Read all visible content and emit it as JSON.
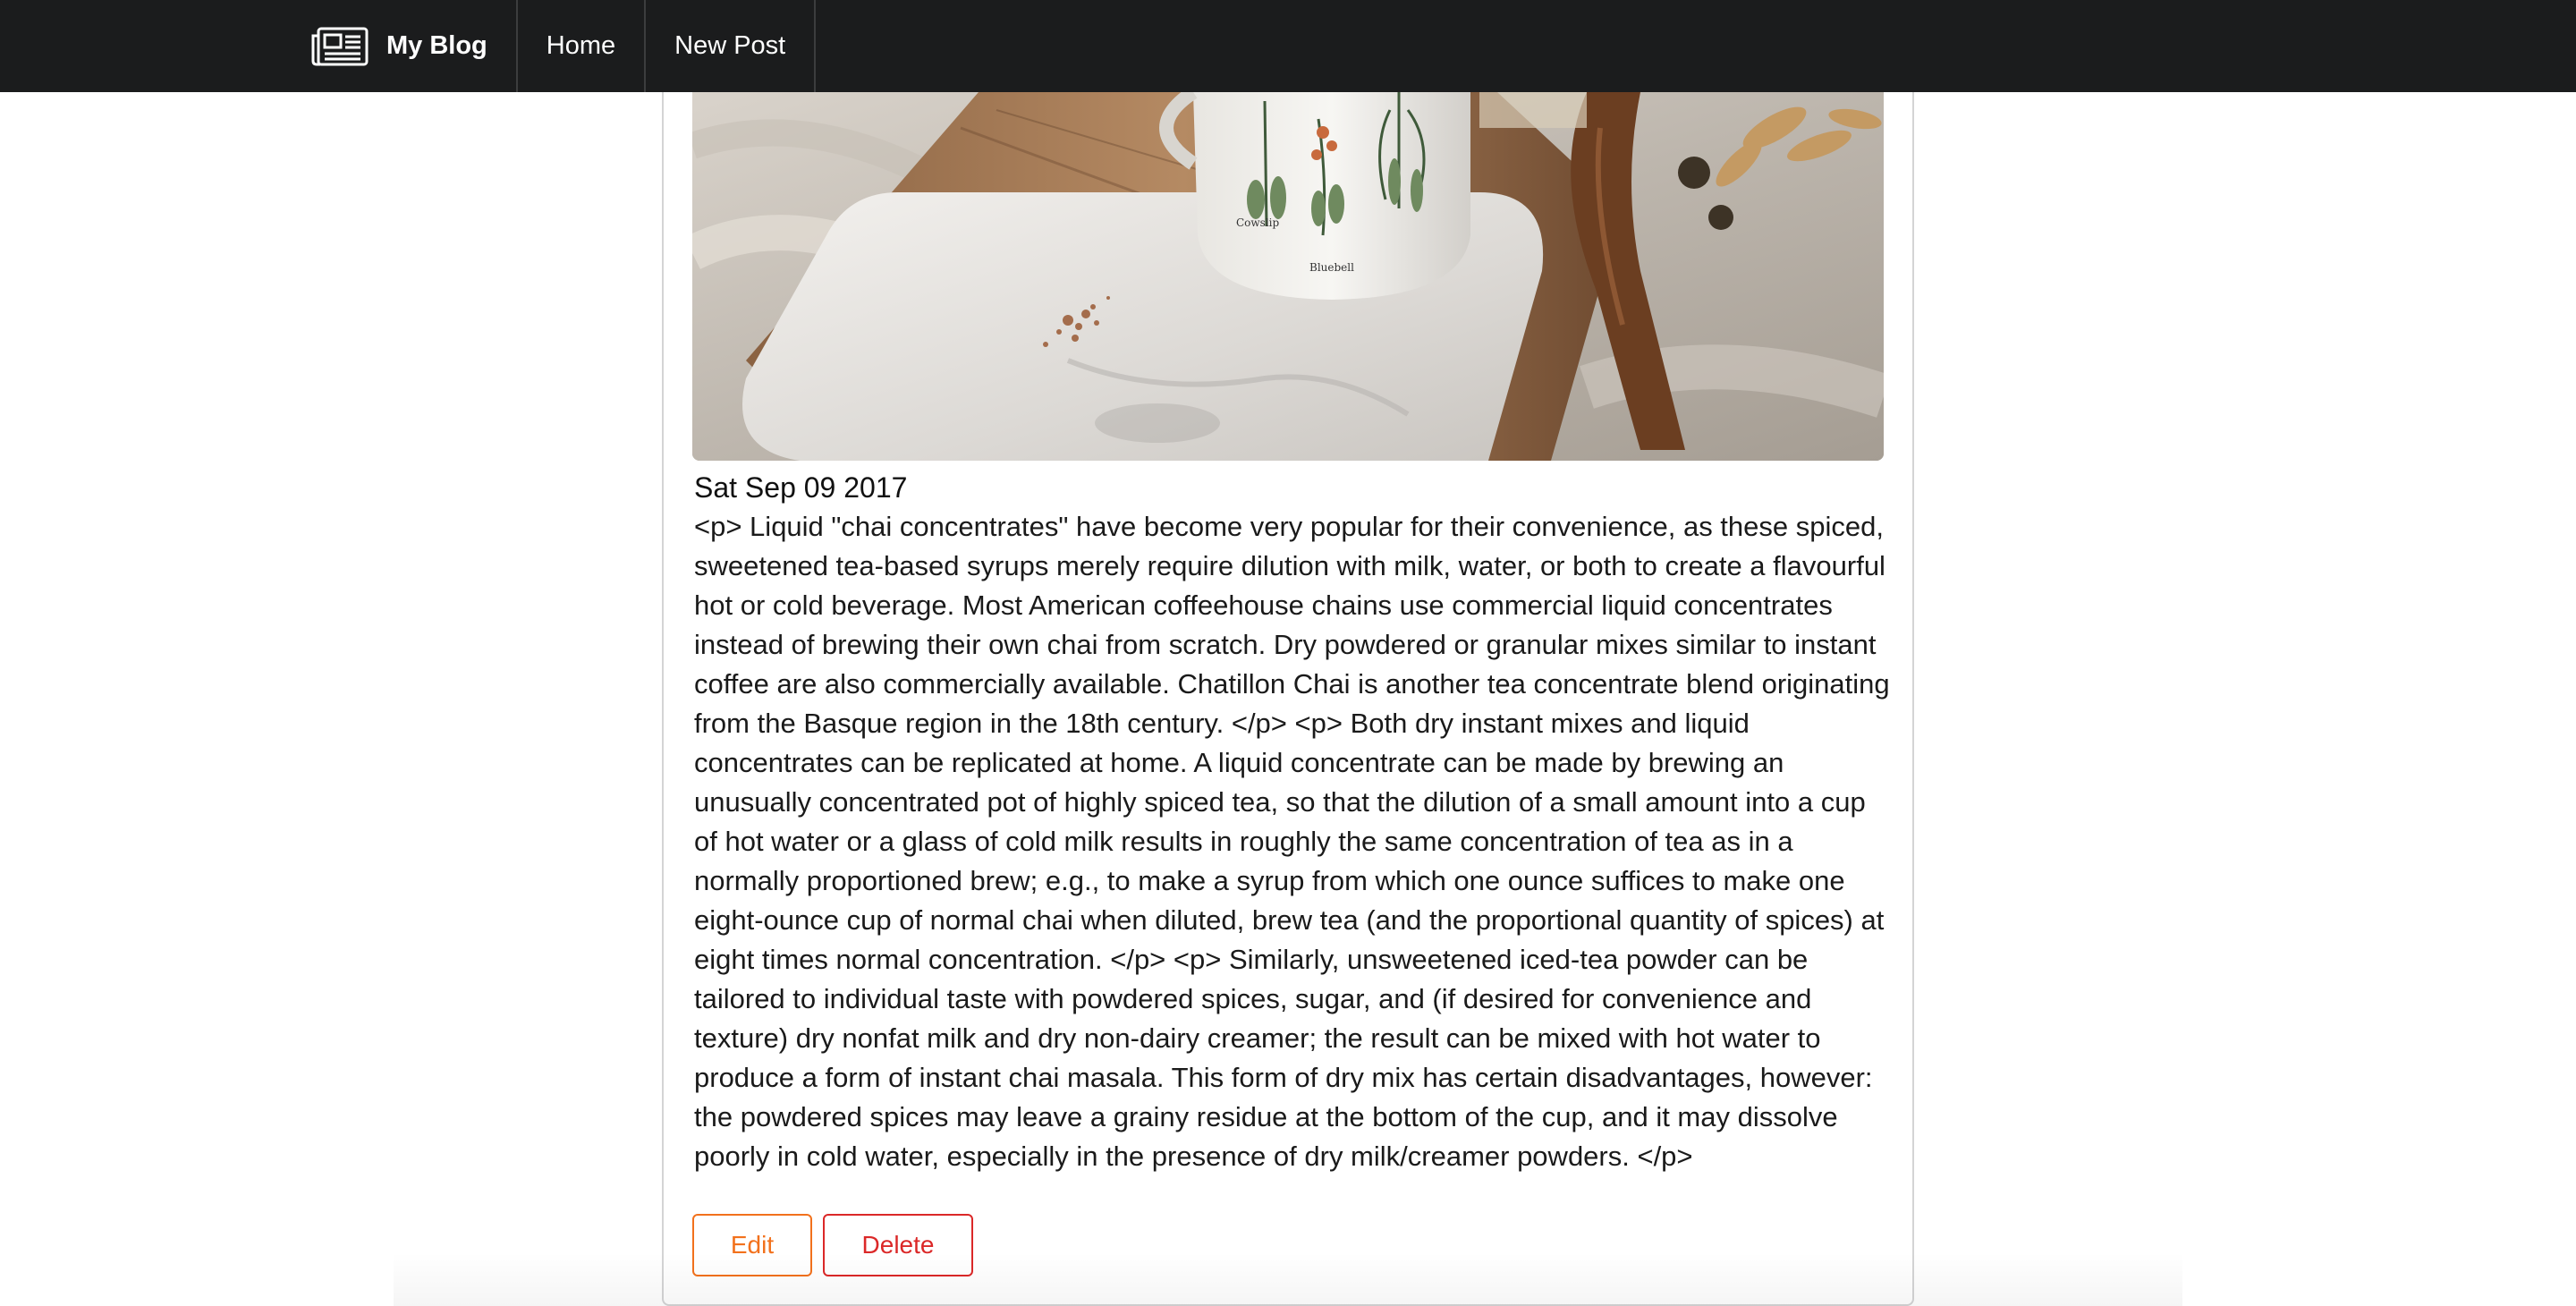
{
  "app": {
    "brand_label": "My Blog",
    "brand_icon": "newspaper-icon"
  },
  "nav": {
    "items": [
      {
        "label": "Home"
      },
      {
        "label": "New Post"
      }
    ]
  },
  "post": {
    "image_alt": "chai mug on wooden board",
    "date": "Sat Sep 09 2017",
    "body": "<p> Liquid \"chai concentrates\" have become very popular for their convenience, as these spiced, sweetened tea-based syrups merely require dilution with milk, water, or both to create a flavourful hot or cold beverage. Most American coffeehouse chains use commercial liquid concentrates instead of brewing their own chai from scratch. Dry powdered or granular mixes similar to instant coffee are also commercially available. Chatillon Chai is another tea concentrate blend originating from the Basque region in the 18th century. </p> <p> Both dry instant mixes and liquid concentrates can be replicated at home. A liquid concentrate can be made by brewing an unusually concentrated pot of highly spiced tea, so that the dilution of a small amount into a cup of hot water or a glass of cold milk results in roughly the same concentration of tea as in a normally proportioned brew; e.g., to make a syrup from which one ounce suffices to make one eight-ounce cup of normal chai when diluted, brew tea (and the proportional quantity of spices) at eight times normal concentration. </p> <p> Similarly, unsweetened iced-tea powder can be tailored to individual taste with powdered spices, sugar, and (if desired for convenience and texture) dry nonfat milk and dry non-dairy creamer; the result can be mixed with hot water to produce a form of instant chai masala. This form of dry mix has certain disadvantages, however: the powdered spices may leave a grainy residue at the bottom of the cup, and it may dissolve poorly in cold water, especially in the presence of dry milk/creamer powders. </p>"
  },
  "actions": {
    "edit_label": "Edit",
    "delete_label": "Delete"
  },
  "colors": {
    "navbar": "#1b1c1d",
    "edit": "#f2711c",
    "delete": "#db2828"
  }
}
